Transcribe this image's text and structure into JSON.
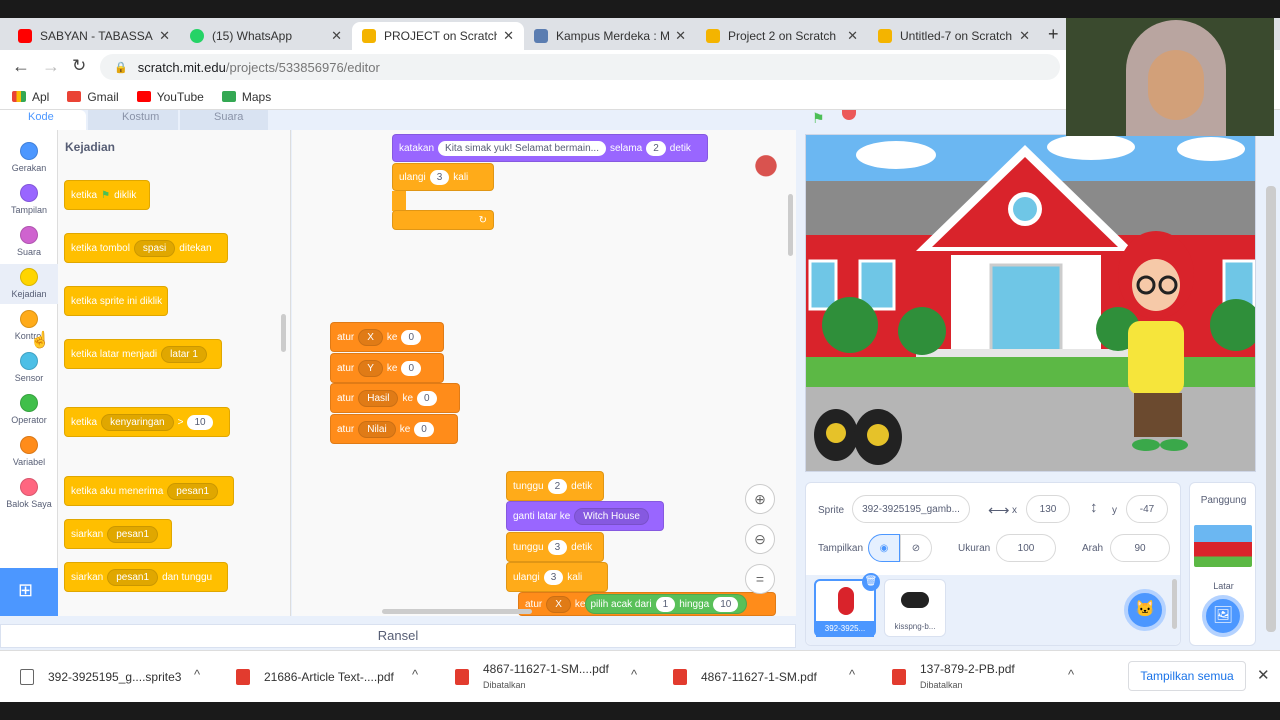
{
  "tabs": [
    {
      "title": "SABYAN - TABASSAM",
      "color": "#ff0000"
    },
    {
      "title": "(15) WhatsApp",
      "color": "#25d366"
    },
    {
      "title": "PROJECT on Scratch",
      "color": "#f4b400"
    },
    {
      "title": "Kampus Merdeka : Me",
      "color": "#5b7db1"
    },
    {
      "title": "Project 2 on Scratch",
      "color": "#f4b400"
    },
    {
      "title": "Untitled-7 on Scratch",
      "color": "#f4b400"
    }
  ],
  "address": {
    "host": "scratch.mit.edu",
    "path": "/projects/533856976/editor"
  },
  "bookmarks": [
    "Apl",
    "Gmail",
    "YouTube",
    "Maps"
  ],
  "editor_tabs": [
    "Kode",
    "Kostum",
    "Suara"
  ],
  "categories": [
    {
      "label": "Gerakan",
      "color": "#4c97ff"
    },
    {
      "label": "Tampilan",
      "color": "#9966ff"
    },
    {
      "label": "Suara",
      "color": "#cf63cf"
    },
    {
      "label": "Kejadian",
      "color": "#ffd500"
    },
    {
      "label": "Kontrol",
      "color": "#ffab19"
    },
    {
      "label": "Sensor",
      "color": "#4cbfe6"
    },
    {
      "label": "Operator",
      "color": "#40bf4a"
    },
    {
      "label": "Variabel",
      "color": "#ff8c1a"
    },
    {
      "label": "Balok Saya",
      "color": "#ff6680"
    }
  ],
  "palette": {
    "heading": "Kejadian",
    "blocks": {
      "flag_a": "ketika",
      "flag_b": "diklik",
      "key_a": "ketika tombol",
      "key_dd": "spasi",
      "key_b": "ditekan",
      "sprite_click": "ketika sprite ini diklik",
      "backdrop_a": "ketika latar menjadi",
      "backdrop_dd": "latar 1",
      "loud_a": "ketika",
      "loud_dd": "kenyaringan",
      "loud_op": ">",
      "loud_val": "10",
      "recv_a": "ketika aku menerima",
      "recv_dd": "pesan1",
      "bc_a": "siarkan",
      "bc_dd": "pesan1",
      "bcw_a": "siarkan",
      "bcw_dd": "pesan1",
      "bcw_b": "dan tunggu"
    }
  },
  "script": {
    "say_a": "katakan",
    "say_text": "Kita simak yuk! Selamat bermain...",
    "say_b": "selama",
    "say_secs": "2",
    "say_c": "detik",
    "rep_a": "ulangi",
    "rep_n": "3",
    "rep_b": "kali",
    "set_word": "atur",
    "to_word": "ke",
    "vars": [
      {
        "name": "X",
        "value": "0"
      },
      {
        "name": "Y",
        "value": "0"
      },
      {
        "name": "Hasil",
        "value": "0"
      },
      {
        "name": "Nilai",
        "value": "0"
      }
    ],
    "wait_a": "tunggu",
    "wait1": "2",
    "wait_b": "detik",
    "switch_a": "ganti latar ke",
    "switch_dd": "Witch House",
    "wait2": "3",
    "rep2_n": "3",
    "last_set_var": "X",
    "random_a": "pilih acak dari",
    "random_from": "1",
    "random_b": "hingga",
    "random_to": "10"
  },
  "sprite_info": {
    "label": "Sprite",
    "name": "392-3925195_gamb...",
    "x_label": "x",
    "x": "130",
    "y_label": "y",
    "y": "-47",
    "show_label": "Tampilkan",
    "size_label": "Ukuran",
    "size": "100",
    "dir_label": "Arah",
    "direction": "90"
  },
  "sprites": [
    "392-3925...",
    "kisspng-b..."
  ],
  "stage_panel": {
    "title": "Panggung",
    "backdrops_label": "Latar"
  },
  "backpack": "Ransel",
  "downloads": [
    {
      "name": "392-3925195_g....sprite3",
      "status": "",
      "type": "file"
    },
    {
      "name": "21686-Article Text-....pdf",
      "status": "",
      "type": "pdf"
    },
    {
      "name": "4867-11627-1-SM....pdf",
      "status": "Dibatalkan",
      "type": "pdf"
    },
    {
      "name": "4867-11627-1-SM.pdf",
      "status": "",
      "type": "pdf"
    },
    {
      "name": "137-879-2-PB.pdf",
      "status": "Dibatalkan",
      "type": "pdf"
    }
  ],
  "show_all": "Tampilkan semua"
}
